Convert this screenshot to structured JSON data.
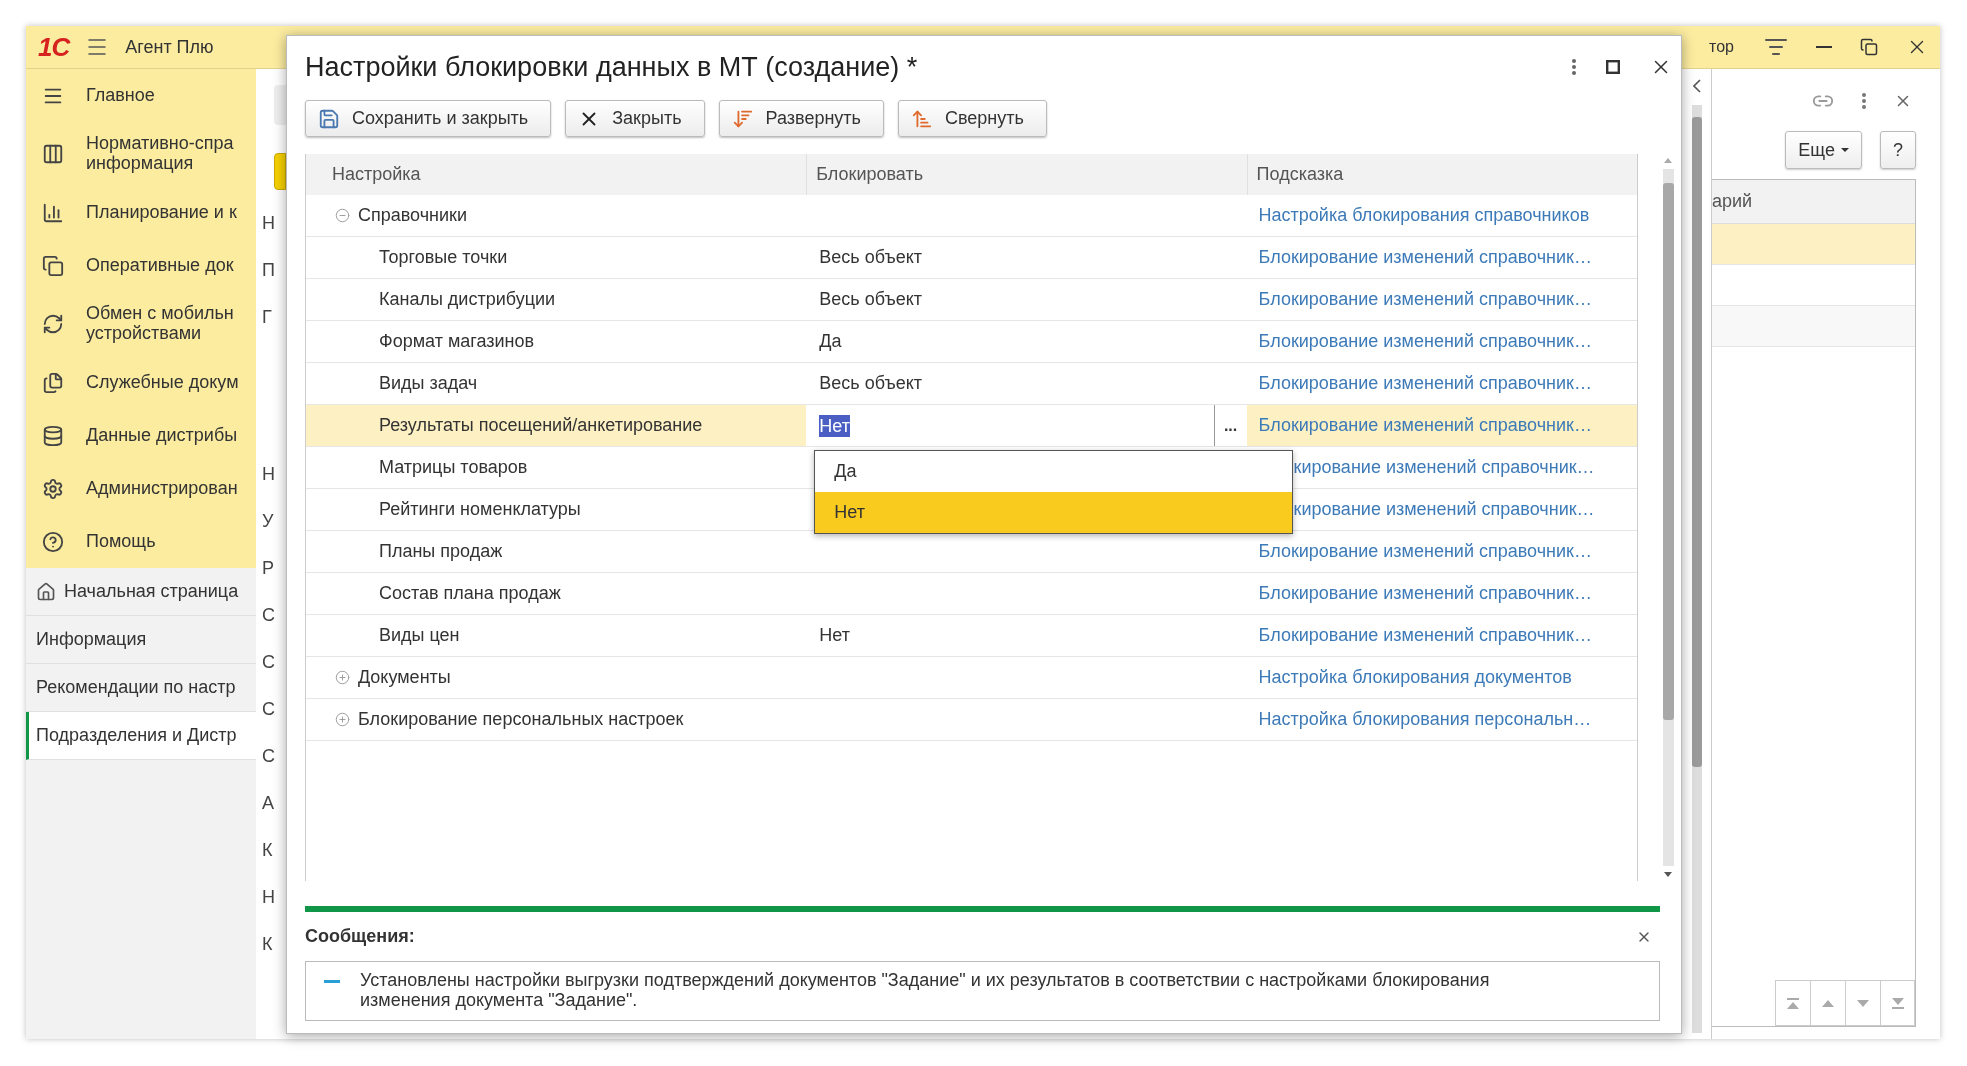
{
  "app": {
    "logo": "1С",
    "title": "Агент Плю",
    "topbar_fragment": "тор"
  },
  "sidebar": {
    "sections": [
      {
        "label": "Главное"
      },
      {
        "label": "Нормативно-спра\nинформация"
      },
      {
        "label": "Планирование и к"
      },
      {
        "label": "Оперативные док"
      },
      {
        "label": "Обмен с мобильн\nустройствами"
      },
      {
        "label": "Служебные докум"
      },
      {
        "label": "Данные дистрибы"
      },
      {
        "label": "Администрирован"
      },
      {
        "label": "Помощь"
      }
    ],
    "pages": [
      {
        "label": "Начальная страница",
        "selected": false
      },
      {
        "label": "Информация",
        "selected": false
      },
      {
        "label": "Рекомендации по настр",
        "selected": false
      },
      {
        "label": "Подразделения и Дистр",
        "selected": true
      }
    ]
  },
  "background_form": {
    "letter_groups": [
      [
        "Н",
        "П",
        "Г"
      ],
      [
        "Н",
        "У",
        "Р",
        "С",
        "С",
        "С",
        "С",
        "А",
        "К",
        "Н",
        "К"
      ]
    ]
  },
  "right_panel": {
    "buttons": [
      {
        "label": "Еще",
        "kind": "menu"
      },
      {
        "label": "?",
        "kind": "plain"
      }
    ],
    "column": "арий",
    "rows": [
      {
        "selected": true
      },
      {
        "selected": false
      },
      {
        "selected": false
      }
    ]
  },
  "dialog": {
    "title": "Настройки блокировки данных в МТ (создание) *",
    "toolbar": [
      "Сохранить и закрыть",
      "Закрыть",
      "Развернуть",
      "Свернуть"
    ],
    "table": {
      "columns": [
        "Настройка",
        "Блокировать",
        "Подсказка"
      ],
      "groups": [
        {
          "setting": "Справочники",
          "hint": "Настройка блокирования справочников",
          "expanded": true,
          "children": [
            {
              "setting": "Торговые точки",
              "block": "Весь объект",
              "hint": "Блокирование изменений справочник…",
              "selected": false
            },
            {
              "setting": "Каналы дистрибуции",
              "block": "Весь объект",
              "hint": "Блокирование изменений справочник…",
              "selected": false
            },
            {
              "setting": "Формат магазинов",
              "block": "Да",
              "hint": "Блокирование изменений справочник…",
              "selected": false
            },
            {
              "setting": "Виды задач",
              "block": "Весь объект",
              "hint": "Блокирование изменений справочник…",
              "selected": false
            },
            {
              "setting": "Результаты посещений/анкетирование",
              "block": "Нет",
              "hint": "Блокирование изменений справочник…",
              "selected": true
            },
            {
              "setting": "Матрицы товаров",
              "hint": "кирование изменений справочник…",
              "selected": false
            },
            {
              "setting": "Рейтинги номенклатуры",
              "hint": "кирование изменений справочник…",
              "selected": false
            },
            {
              "setting": "Планы продаж",
              "hint": "Блокирование изменений справочник…",
              "selected": false
            },
            {
              "setting": "Состав плана продаж",
              "hint": "Блокирование изменений справочник…",
              "selected": false
            },
            {
              "setting": "Виды цен",
              "block": "Нет",
              "hint": "Блокирование изменений справочник…",
              "selected": false
            }
          ]
        },
        {
          "setting": "Документы",
          "hint": "Настройка блокирования документов",
          "expanded": false
        },
        {
          "setting": "Блокирование персональных настроек",
          "hint": "Настройка блокирования персональн…",
          "expanded": false
        }
      ],
      "edit_button": "...",
      "dropdown": [
        {
          "label": "Да",
          "selected": false
        },
        {
          "label": "Нет",
          "selected": true
        }
      ]
    },
    "messages": {
      "title": "Сообщения:",
      "items": [
        "Установлены настройки выгрузки подтверждений документов \"Задание\" и их результатов в соответствии с настройками блокирования изменения документа \"Задание\"."
      ]
    }
  }
}
